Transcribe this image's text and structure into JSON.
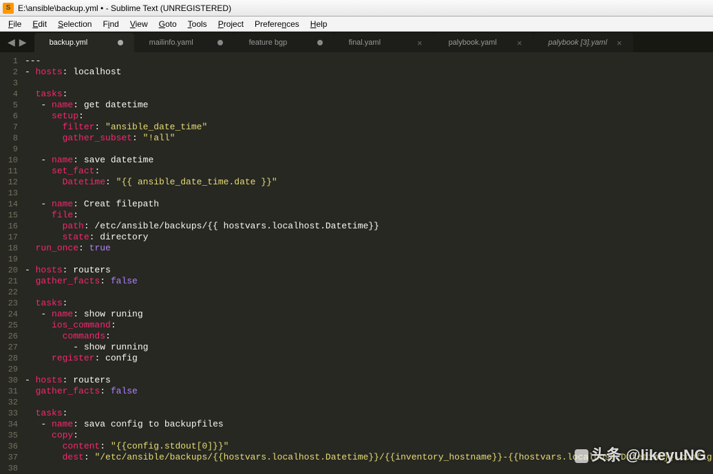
{
  "title": "E:\\ansible\\backup.yml • - Sublime Text (UNREGISTERED)",
  "menu": {
    "file": "File",
    "edit": "Edit",
    "selection": "Selection",
    "find": "Find",
    "view": "View",
    "goto": "Goto",
    "tools": "Tools",
    "project": "Project",
    "preferences": "Preferences",
    "help": "Help"
  },
  "tabs": [
    {
      "label": "backup.yml",
      "dirty": true,
      "active": true
    },
    {
      "label": "mailinfo.yaml",
      "dirty": true,
      "active": false
    },
    {
      "label": "feature bgp",
      "dirty": true,
      "active": false
    },
    {
      "label": "final.yaml",
      "dirty": false,
      "active": false
    },
    {
      "label": "palybook.yaml",
      "dirty": false,
      "active": false
    },
    {
      "label": "palybook [3].yaml",
      "dirty": false,
      "active": false,
      "italic": true
    }
  ],
  "code_lines": [
    {
      "n": 1,
      "tokens": [
        {
          "c": "t-plain",
          "t": "---"
        }
      ]
    },
    {
      "n": 2,
      "tokens": [
        {
          "c": "t-dash",
          "t": "- "
        },
        {
          "c": "t-key",
          "t": "hosts"
        },
        {
          "c": "t-plain",
          "t": ": localhost"
        }
      ]
    },
    {
      "n": 3,
      "tokens": []
    },
    {
      "n": 4,
      "tokens": [
        {
          "c": "t-plain",
          "t": "  "
        },
        {
          "c": "t-key",
          "t": "tasks"
        },
        {
          "c": "t-plain",
          "t": ":"
        }
      ]
    },
    {
      "n": 5,
      "tokens": [
        {
          "c": "t-plain",
          "t": "   "
        },
        {
          "c": "t-dash",
          "t": "- "
        },
        {
          "c": "t-key",
          "t": "name"
        },
        {
          "c": "t-plain",
          "t": ": get datetime"
        }
      ]
    },
    {
      "n": 6,
      "tokens": [
        {
          "c": "t-plain",
          "t": "     "
        },
        {
          "c": "t-key",
          "t": "setup"
        },
        {
          "c": "t-plain",
          "t": ":"
        }
      ]
    },
    {
      "n": 7,
      "tokens": [
        {
          "c": "t-plain",
          "t": "       "
        },
        {
          "c": "t-key",
          "t": "filter"
        },
        {
          "c": "t-plain",
          "t": ": "
        },
        {
          "c": "t-str",
          "t": "\"ansible_date_time\""
        }
      ]
    },
    {
      "n": 8,
      "tokens": [
        {
          "c": "t-plain",
          "t": "       "
        },
        {
          "c": "t-key",
          "t": "gather_subset"
        },
        {
          "c": "t-plain",
          "t": ": "
        },
        {
          "c": "t-str",
          "t": "\"!all\""
        }
      ]
    },
    {
      "n": 9,
      "tokens": []
    },
    {
      "n": 10,
      "tokens": [
        {
          "c": "t-plain",
          "t": "   "
        },
        {
          "c": "t-dash",
          "t": "- "
        },
        {
          "c": "t-key",
          "t": "name"
        },
        {
          "c": "t-plain",
          "t": ": save datetime"
        }
      ]
    },
    {
      "n": 11,
      "tokens": [
        {
          "c": "t-plain",
          "t": "     "
        },
        {
          "c": "t-key",
          "t": "set_fact"
        },
        {
          "c": "t-plain",
          "t": ":"
        }
      ]
    },
    {
      "n": 12,
      "tokens": [
        {
          "c": "t-plain",
          "t": "       "
        },
        {
          "c": "t-key",
          "t": "Datetime"
        },
        {
          "c": "t-plain",
          "t": ": "
        },
        {
          "c": "t-str",
          "t": "\"{{ ansible_date_time.date }}\""
        }
      ]
    },
    {
      "n": 13,
      "tokens": []
    },
    {
      "n": 14,
      "tokens": [
        {
          "c": "t-plain",
          "t": "   "
        },
        {
          "c": "t-dash",
          "t": "- "
        },
        {
          "c": "t-key",
          "t": "name"
        },
        {
          "c": "t-plain",
          "t": ": Creat filepath"
        }
      ]
    },
    {
      "n": 15,
      "tokens": [
        {
          "c": "t-plain",
          "t": "     "
        },
        {
          "c": "t-key",
          "t": "file"
        },
        {
          "c": "t-plain",
          "t": ":"
        }
      ]
    },
    {
      "n": 16,
      "tokens": [
        {
          "c": "t-plain",
          "t": "       "
        },
        {
          "c": "t-key",
          "t": "path"
        },
        {
          "c": "t-plain",
          "t": ": /etc/ansible/backups/{{ hostvars.localhost.Datetime}}"
        }
      ]
    },
    {
      "n": 17,
      "tokens": [
        {
          "c": "t-plain",
          "t": "       "
        },
        {
          "c": "t-key",
          "t": "state"
        },
        {
          "c": "t-plain",
          "t": ": directory"
        }
      ]
    },
    {
      "n": 18,
      "tokens": [
        {
          "c": "t-plain",
          "t": "  "
        },
        {
          "c": "t-key",
          "t": "run_once"
        },
        {
          "c": "t-plain",
          "t": ": "
        },
        {
          "c": "t-kw",
          "t": "true"
        }
      ]
    },
    {
      "n": 19,
      "tokens": []
    },
    {
      "n": 20,
      "tokens": [
        {
          "c": "t-dash",
          "t": "- "
        },
        {
          "c": "t-key",
          "t": "hosts"
        },
        {
          "c": "t-plain",
          "t": ": routers"
        }
      ]
    },
    {
      "n": 21,
      "tokens": [
        {
          "c": "t-plain",
          "t": "  "
        },
        {
          "c": "t-key",
          "t": "gather_facts"
        },
        {
          "c": "t-plain",
          "t": ": "
        },
        {
          "c": "t-kw",
          "t": "false"
        }
      ]
    },
    {
      "n": 22,
      "tokens": []
    },
    {
      "n": 23,
      "tokens": [
        {
          "c": "t-plain",
          "t": "  "
        },
        {
          "c": "t-key",
          "t": "tasks"
        },
        {
          "c": "t-plain",
          "t": ":"
        }
      ]
    },
    {
      "n": 24,
      "tokens": [
        {
          "c": "t-plain",
          "t": "   "
        },
        {
          "c": "t-dash",
          "t": "- "
        },
        {
          "c": "t-key",
          "t": "name"
        },
        {
          "c": "t-plain",
          "t": ": show runing"
        }
      ]
    },
    {
      "n": 25,
      "tokens": [
        {
          "c": "t-plain",
          "t": "     "
        },
        {
          "c": "t-key",
          "t": "ios_command"
        },
        {
          "c": "t-plain",
          "t": ":"
        }
      ]
    },
    {
      "n": 26,
      "tokens": [
        {
          "c": "t-plain",
          "t": "       "
        },
        {
          "c": "t-key",
          "t": "commands"
        },
        {
          "c": "t-plain",
          "t": ":"
        }
      ]
    },
    {
      "n": 27,
      "tokens": [
        {
          "c": "t-plain",
          "t": "         - show running"
        }
      ]
    },
    {
      "n": 28,
      "tokens": [
        {
          "c": "t-plain",
          "t": "     "
        },
        {
          "c": "t-key",
          "t": "register"
        },
        {
          "c": "t-plain",
          "t": ": config"
        }
      ]
    },
    {
      "n": 29,
      "tokens": []
    },
    {
      "n": 30,
      "tokens": [
        {
          "c": "t-dash",
          "t": "- "
        },
        {
          "c": "t-key",
          "t": "hosts"
        },
        {
          "c": "t-plain",
          "t": ": routers"
        }
      ]
    },
    {
      "n": 31,
      "tokens": [
        {
          "c": "t-plain",
          "t": "  "
        },
        {
          "c": "t-key",
          "t": "gather_facts"
        },
        {
          "c": "t-plain",
          "t": ": "
        },
        {
          "c": "t-kw",
          "t": "false"
        }
      ]
    },
    {
      "n": 32,
      "tokens": []
    },
    {
      "n": 33,
      "tokens": [
        {
          "c": "t-plain",
          "t": "  "
        },
        {
          "c": "t-key",
          "t": "tasks"
        },
        {
          "c": "t-plain",
          "t": ":"
        }
      ]
    },
    {
      "n": 34,
      "tokens": [
        {
          "c": "t-plain",
          "t": "   "
        },
        {
          "c": "t-dash",
          "t": "- "
        },
        {
          "c": "t-key",
          "t": "name"
        },
        {
          "c": "t-plain",
          "t": ": sava config to backupfiles"
        }
      ]
    },
    {
      "n": 35,
      "tokens": [
        {
          "c": "t-plain",
          "t": "     "
        },
        {
          "c": "t-key",
          "t": "copy"
        },
        {
          "c": "t-plain",
          "t": ":"
        }
      ]
    },
    {
      "n": 36,
      "tokens": [
        {
          "c": "t-plain",
          "t": "       "
        },
        {
          "c": "t-key",
          "t": "content"
        },
        {
          "c": "t-plain",
          "t": ": "
        },
        {
          "c": "t-str",
          "t": "\"{{config.stdout[0]}}\""
        }
      ]
    },
    {
      "n": 37,
      "tokens": [
        {
          "c": "t-plain",
          "t": "       "
        },
        {
          "c": "t-key",
          "t": "dest"
        },
        {
          "c": "t-plain",
          "t": ": "
        },
        {
          "c": "t-str",
          "t": "\"/etc/ansible/backups/{{hostvars.localhost.Datetime}}/{{inventory_hostname}}-{{hostvars.localhost.Datetime}}-config.cfg"
        }
      ]
    },
    {
      "n": 38,
      "tokens": []
    }
  ],
  "watermark": "头条 @likeyuNG"
}
